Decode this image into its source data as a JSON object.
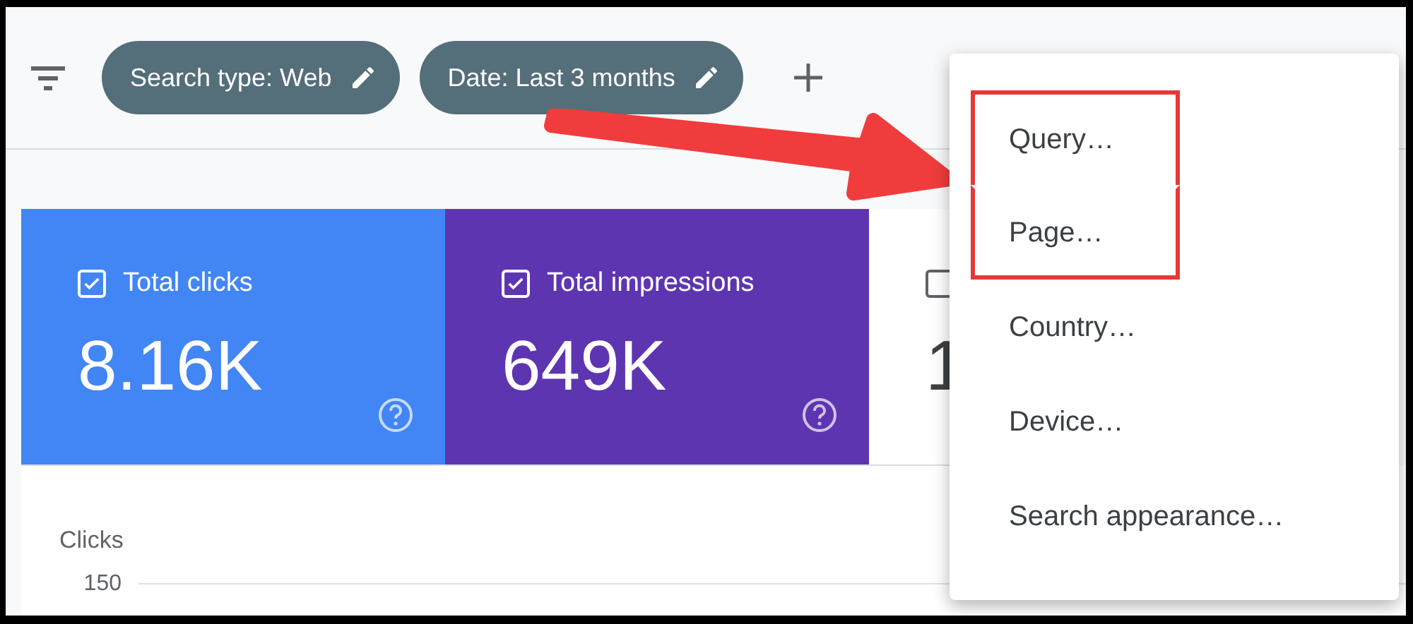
{
  "filter_chips": [
    {
      "label": "Search type: Web"
    },
    {
      "label": "Date: Last 3 months"
    }
  ],
  "metric_cards": [
    {
      "label": "Total clicks",
      "value": "8.16K",
      "checked": true,
      "color": "#4285f4"
    },
    {
      "label": "Total impressions",
      "value": "649K",
      "checked": true,
      "color": "#5e35b1"
    },
    {
      "value": "1",
      "checked": false
    }
  ],
  "chart": {
    "ylabel": "Clicks",
    "ytick": "150"
  },
  "menu": {
    "items": [
      {
        "label": "Query…",
        "highlighted": true
      },
      {
        "label": "Page…",
        "highlighted": true
      },
      {
        "label": "Country…",
        "highlighted": false
      },
      {
        "label": "Device…",
        "highlighted": false
      },
      {
        "label": "Search appearance…",
        "highlighted": false
      }
    ]
  }
}
